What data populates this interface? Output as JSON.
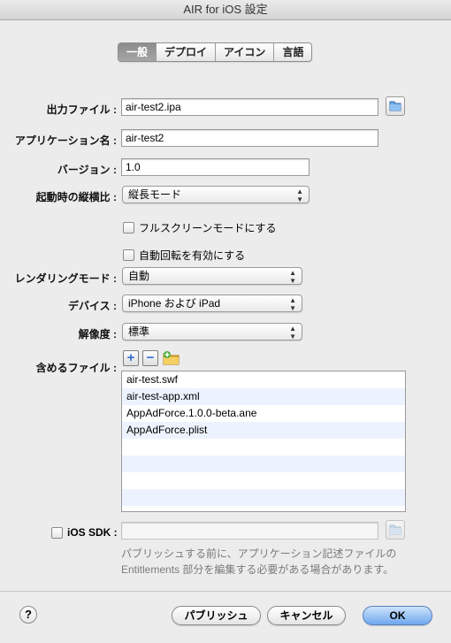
{
  "window": {
    "title": "AIR for iOS 設定"
  },
  "tabs": [
    {
      "label": "一般",
      "active": true
    },
    {
      "label": "デプロイ",
      "active": false
    },
    {
      "label": "アイコン",
      "active": false
    },
    {
      "label": "言語",
      "active": false
    }
  ],
  "form": {
    "output_file": {
      "label": "出力ファイル :",
      "value": "air-test2.ipa"
    },
    "app_name": {
      "label": "アプリケーション名 :",
      "value": "air-test2"
    },
    "version": {
      "label": "バージョン :",
      "value": "1.0"
    },
    "aspect_ratio": {
      "label": "起動時の縦横比 :",
      "value": "縦長モード"
    },
    "fullscreen": {
      "label": "フルスクリーンモードにする",
      "checked": false
    },
    "auto_orient": {
      "label": "自動回転を有効にする",
      "checked": false
    },
    "render_mode": {
      "label": "レンダリングモード :",
      "value": "自動"
    },
    "device": {
      "label": "デバイス :",
      "value": "iPhone および iPad"
    },
    "resolution": {
      "label": "解像度 :",
      "value": "標準"
    },
    "included_files": {
      "label": "含めるファイル :",
      "add": "+",
      "remove": "−",
      "files": [
        "air-test.swf",
        "air-test-app.xml",
        "AppAdForce.1.0.0-beta.ane",
        "AppAdForce.plist"
      ]
    },
    "ios_sdk": {
      "label": "iOS SDK :",
      "checked": false,
      "value": ""
    },
    "note": "パブリッシュする前に、アプリケーション記述ファイルの Entitlements 部分を編集する必要がある場合があります。"
  },
  "footer": {
    "help": "?",
    "publish": "パブリッシュ",
    "cancel": "キャンセル",
    "ok": "OK"
  },
  "colors": {
    "accent": "#6ea7ef",
    "row_alt": "#edf3fe"
  },
  "icons": [
    "folder-icon",
    "plus-icon",
    "minus-icon",
    "add-folder-icon",
    "up-down-arrows-icon"
  ]
}
